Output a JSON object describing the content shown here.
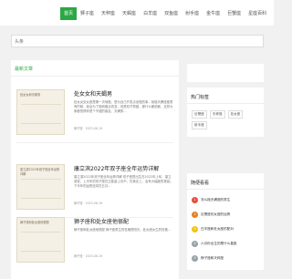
{
  "nav": {
    "items": [
      "首页",
      "狮子座",
      "天秤座",
      "天蝎座",
      "白羊座",
      "双鱼座",
      "射手座",
      "金牛座",
      "巨蟹座",
      "星座百科"
    ],
    "active_index": 0
  },
  "search": {
    "text": "头条"
  },
  "main": {
    "heading": "最新文章",
    "articles": [
      {
        "thumb_text": "处女女和天蝎男",
        "title": "处女女和天蝎男",
        "excerpt": "处女女处女座是第一次地做，是为自己开发点该做的事，就能天蝎座座男有时候，我会为了她而做点改变，但是双子男做，那什么都依赖，这样大家都觉得你是个不错的朋友。天蝎男…",
        "meta": "狮子座 · 2023-06-19"
      },
      {
        "thumb_text": "康立滨2022年双子座全年运势详解",
        "title": "康立滨2022年双子座全年运势详解",
        "excerpt": "康立滨2022年双子座全年运势详解 双子座是出生在2022年上旬，康立滨说，上半年的双子座在正能量上也不，在事业上，会有大幅度的提高；下半年的运势还将在五月…",
        "meta": "狮子座 · 2023-06-19"
      },
      {
        "thumb_text": "狮子座和处女座他很配",
        "title": "狮子座和处女座他很配",
        "excerpt": "狮子座和处女座他很配 狮子座男生的性格很阳光，处女座女生的性格…",
        "meta": "狮子座 · 2023-06-19"
      }
    ]
  },
  "sidebar": {
    "tags_title": "热门标签",
    "tags": [
      "巨蟹座",
      "天秤座",
      "处女座",
      "射手座"
    ],
    "recent_title": "随便看看",
    "recent": [
      {
        "num": "1",
        "text": "怎么挽天蝎座的男生"
      },
      {
        "num": "2",
        "text": "巨蟹座处女座的运势"
      },
      {
        "num": "3",
        "text": "白羊座和处女座的配对"
      },
      {
        "num": "4",
        "text": "六月份出生的是什么星座"
      },
      {
        "num": "5",
        "text": "狮子座和天秤座"
      }
    ],
    "num_colors": [
      "#e74c3c",
      "#e67e22",
      "#f1c40f",
      "#95a5a6",
      "#95a5a6"
    ]
  },
  "colors": {
    "accent": "#2aa845"
  }
}
